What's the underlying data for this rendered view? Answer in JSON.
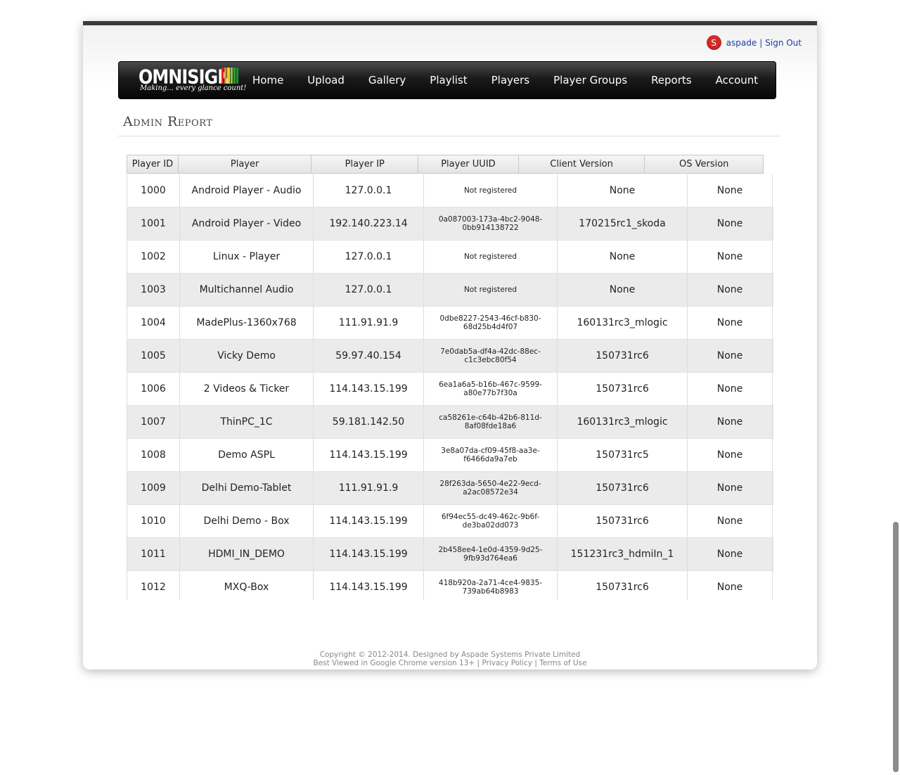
{
  "user": {
    "avatar_letter": "S",
    "name": "aspade",
    "separator": "|",
    "signout": "Sign Out"
  },
  "logo": {
    "word": "OMNISIGN",
    "tagline": "Making... every glance count!",
    "bar_colors": [
      "#e22020",
      "#f08a1a",
      "#f4d020",
      "#8cc63f",
      "#2e9e3e",
      "#1e8f3e"
    ]
  },
  "nav": {
    "items": [
      {
        "label": "Home"
      },
      {
        "label": "Upload"
      },
      {
        "label": "Gallery"
      },
      {
        "label": "Playlist"
      },
      {
        "label": "Players"
      },
      {
        "label": "Player Groups"
      },
      {
        "label": "Reports"
      },
      {
        "label": "Account"
      }
    ]
  },
  "page": {
    "title": "Admin Report"
  },
  "table": {
    "columns": [
      "Player ID",
      "Player",
      "Player IP",
      "Player UUID",
      "Client Version",
      "OS Version"
    ],
    "rows": [
      [
        "1000",
        "Android Player - Audio",
        "127.0.0.1",
        "Not registered",
        "None",
        "None"
      ],
      [
        "1001",
        "Android Player - Video",
        "192.140.223.14",
        "0a087003-173a-4bc2-9048-0bb914138722",
        "170215rc1_skoda",
        "None"
      ],
      [
        "1002",
        "Linux - Player",
        "127.0.0.1",
        "Not registered",
        "None",
        "None"
      ],
      [
        "1003",
        "Multichannel Audio",
        "127.0.0.1",
        "Not registered",
        "None",
        "None"
      ],
      [
        "1004",
        "MadePlus-1360x768",
        "111.91.91.9",
        "0dbe8227-2543-46cf-b830-68d25b4d4f07",
        "160131rc3_mlogic",
        "None"
      ],
      [
        "1005",
        "Vicky Demo",
        "59.97.40.154",
        "7e0dab5a-df4a-42dc-88ec-c1c3ebc80f54",
        "150731rc6",
        "None"
      ],
      [
        "1006",
        "2 Videos & Ticker",
        "114.143.15.199",
        "6ea1a6a5-b16b-467c-9599-a80e77b7f30a",
        "150731rc6",
        "None"
      ],
      [
        "1007",
        "ThinPC_1C",
        "59.181.142.50",
        "ca58261e-c64b-42b6-811d-8af08fde18a6",
        "160131rc3_mlogic",
        "None"
      ],
      [
        "1008",
        "Demo ASPL",
        "114.143.15.199",
        "3e8a07da-cf09-45f8-aa3e-f6466da9a7eb",
        "150731rc5",
        "None"
      ],
      [
        "1009",
        "Delhi Demo-Tablet",
        "111.91.91.9",
        "28f263da-5650-4e22-9ecd-a2ac08572e34",
        "150731rc6",
        "None"
      ],
      [
        "1010",
        "Delhi Demo - Box",
        "114.143.15.199",
        "6f94ec55-dc49-462c-9b6f-de3ba02dd073",
        "150731rc6",
        "None"
      ],
      [
        "1011",
        "HDMI_IN_DEMO",
        "114.143.15.199",
        "2b458ee4-1e0d-4359-9d25-9fb93d764ea6",
        "151231rc3_hdmiIn_1",
        "None"
      ],
      [
        "1012",
        "MXQ-Box",
        "114.143.15.199",
        "418b920a-2a71-4ce4-9835-739ab64b8983",
        "150731rc6",
        "None"
      ]
    ]
  },
  "footer": {
    "line1": "Copyright © 2012-2014. Designed by Aspade Systems Private Limited",
    "line2_prefix": "Best Viewed in Google Chrome version 13+",
    "sep": "|",
    "privacy": "Privacy Policy",
    "terms": "Terms of Use"
  }
}
